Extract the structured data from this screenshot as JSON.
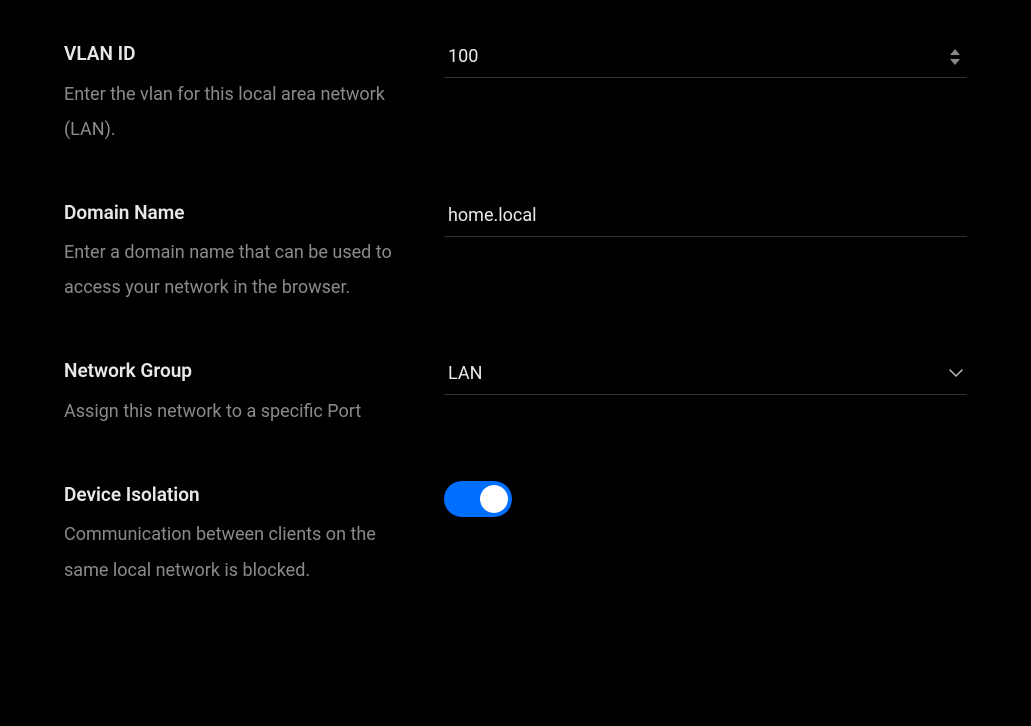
{
  "vlan": {
    "title": "VLAN ID",
    "desc": "Enter the vlan for this local area network (LAN).",
    "value": "100"
  },
  "domain": {
    "title": "Domain Name",
    "desc": "Enter a domain name that can be used to access your network in the browser.",
    "value": "home.local"
  },
  "network_group": {
    "title": "Network Group",
    "desc": "Assign this network to a specific Port",
    "value": "LAN"
  },
  "device_isolation": {
    "title": "Device Isolation",
    "desc": "Communication between clients on the same local network is blocked.",
    "enabled": true
  }
}
